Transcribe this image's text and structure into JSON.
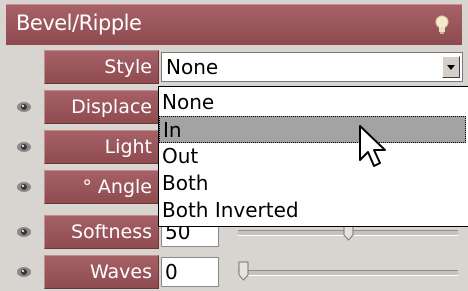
{
  "panel": {
    "title": "Bevel/Ripple",
    "header_icon": "lightbulb-icon"
  },
  "rows": [
    {
      "label": "Style",
      "value": "None",
      "has_eye": false,
      "type": "select"
    },
    {
      "label": "Displace",
      "has_eye": true
    },
    {
      "label": "Light",
      "has_eye": true
    },
    {
      "label": "° Angle",
      "has_eye": true
    },
    {
      "label": "Softness",
      "value": "50",
      "has_eye": true,
      "slider_fraction": 0.5
    },
    {
      "label": "Waves",
      "value": "0",
      "has_eye": true,
      "slider_fraction": 0.0
    }
  ],
  "dropdown": {
    "options": [
      "None",
      "In",
      "Out",
      "Both",
      "Both Inverted"
    ],
    "highlighted": "In"
  },
  "colors": {
    "accent": "#9a555a",
    "panel_bg": "#d8d4d0",
    "highlight": "#a3a3a3"
  }
}
